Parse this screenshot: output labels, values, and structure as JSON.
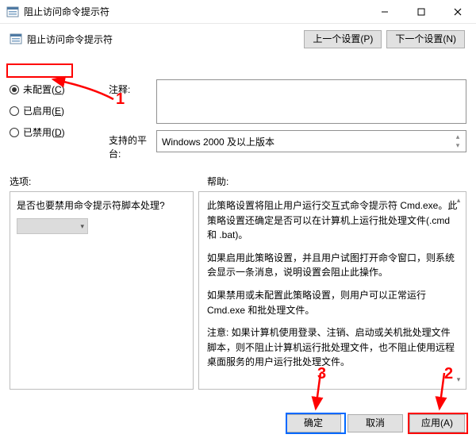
{
  "window": {
    "title": "阻止访问命令提示符",
    "subtitle": "阻止访问命令提示符"
  },
  "nav": {
    "prev": "上一个设置(P)",
    "next": "下一个设置(N)"
  },
  "radios": {
    "not_configured": "未配置(C)",
    "enabled": "已启用(E)",
    "disabled": "已禁用(D)"
  },
  "fields": {
    "comment_label": "注释:",
    "comment_value": "",
    "platform_label": "支持的平台:",
    "platform_value": "Windows 2000 及以上版本"
  },
  "sections": {
    "options": "选项:",
    "help": "帮助:"
  },
  "options": {
    "question": "是否也要禁用命令提示符脚本处理?"
  },
  "help": {
    "p1": "此策略设置将阻止用户运行交互式命令提示符 Cmd.exe。此策略设置还确定是否可以在计算机上运行批处理文件(.cmd 和 .bat)。",
    "p2": "如果启用此策略设置，并且用户试图打开命令窗口，则系统会显示一条消息，说明设置会阻止此操作。",
    "p3": "如果禁用或未配置此策略设置，则用户可以正常运行 Cmd.exe 和批处理文件。",
    "p4": "注意: 如果计算机使用登录、注销、启动或关机批处理文件脚本，则不阻止计算机运行批处理文件，也不阻止使用远程桌面服务的用户运行批处理文件。"
  },
  "footer": {
    "ok": "确定",
    "cancel": "取消",
    "apply": "应用(A)"
  },
  "annotations": {
    "n1": "1",
    "n2": "2",
    "n3": "3"
  }
}
